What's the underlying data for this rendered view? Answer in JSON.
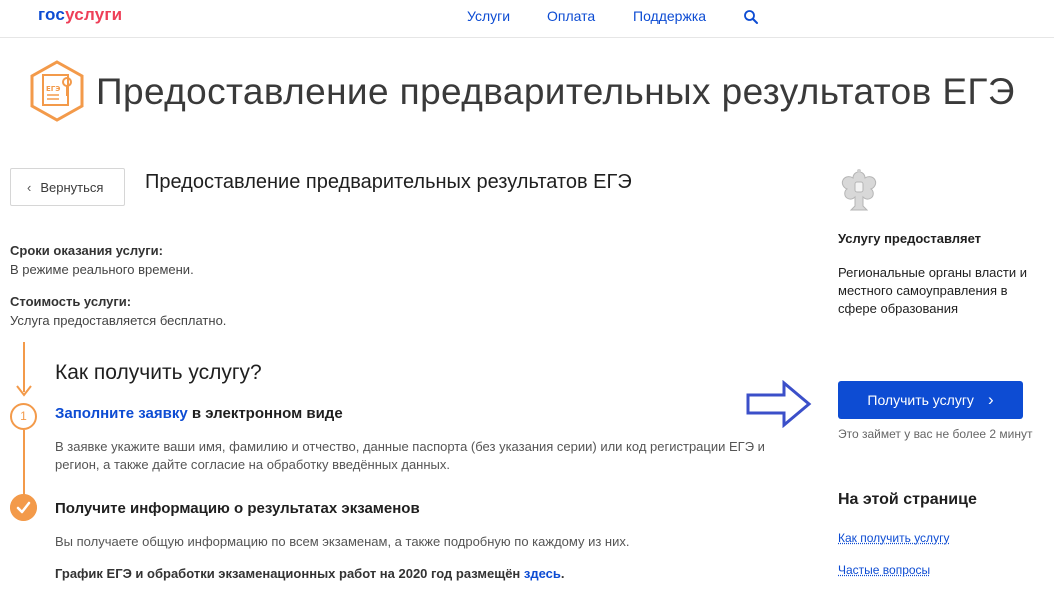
{
  "header": {
    "logo": {
      "part1": "гос",
      "part2": "услуги"
    },
    "nav": [
      "Услуги",
      "Оплата",
      "Поддержка"
    ],
    "search_icon": "search-icon"
  },
  "page": {
    "title": "Предоставление предварительных результатов ЕГЭ",
    "emblem_text": "ЕГЭ",
    "back_label": "Вернуться",
    "subtitle": "Предоставление предварительных результатов ЕГЭ"
  },
  "info": {
    "terms_label": "Сроки оказания услуги:",
    "terms_value": "В режиме реального времени.",
    "cost_label": "Стоимость услуги:",
    "cost_value": "Услуга предоставляется бесплатно."
  },
  "how": {
    "title": "Как получить услугу?",
    "step1": {
      "number": "1",
      "link_text": "Заполните заявку",
      "rest_text": " в электронном виде",
      "description": "В заявке укажите ваши имя, фамилию и отчество, данные паспорта (без указания серии) или код регистрации ЕГЭ и регион, а также дайте согласие на обработку введённых данных."
    },
    "step2": {
      "title": "Получите информацию о результатах экзаменов",
      "description": "Вы получаете общую информацию по всем экзаменам, а также подробную по каждому из них."
    },
    "schedule_text": "График ЕГЭ и обработки экзаменационных работ на 2020 год размещён ",
    "schedule_link": "здесь",
    "schedule_end": "."
  },
  "sidebar": {
    "provider_head": "Услугу предоставляет",
    "provider_text": "Региональные органы власти и местного самоуправления в сфере образования",
    "get_button": "Получить услугу",
    "get_note": "Это займет у вас не более 2 минут",
    "onpage_head": "На этой странице",
    "onpage_links": [
      "Как получить услугу",
      "Частые вопросы"
    ]
  },
  "colors": {
    "brand_blue": "#0d4cd3",
    "brand_red": "#ee3f58",
    "step_orange": "#f39a4a",
    "annotation_arrow": "#3b4fc9"
  }
}
